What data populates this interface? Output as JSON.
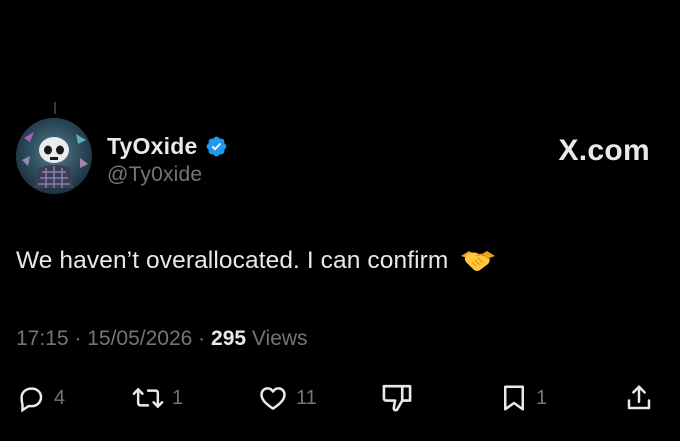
{
  "author": {
    "display_name": "TyOxide",
    "handle": "@Ty0xide",
    "verified": true
  },
  "brand": "X.com",
  "tweet": {
    "text": "We haven’t overallocated. I can confirm",
    "emoji": "handshake"
  },
  "meta": {
    "time": "17:15",
    "separator": " · ",
    "date": "15/05/2026",
    "views_count": "295",
    "views_label": "Views"
  },
  "actions": {
    "replies": "4",
    "reposts": "1",
    "likes": "11",
    "bookmarks": "1"
  },
  "colors": {
    "background": "#000000",
    "text_primary": "#e7e9ea",
    "text_secondary": "#71767b",
    "verified_badge": "#1d9bf0"
  },
  "icons": [
    "reply-icon",
    "repost-icon",
    "like-icon",
    "dislike-icon",
    "bookmark-icon",
    "share-icon",
    "verified-badge-icon",
    "handshake-emoji"
  ]
}
